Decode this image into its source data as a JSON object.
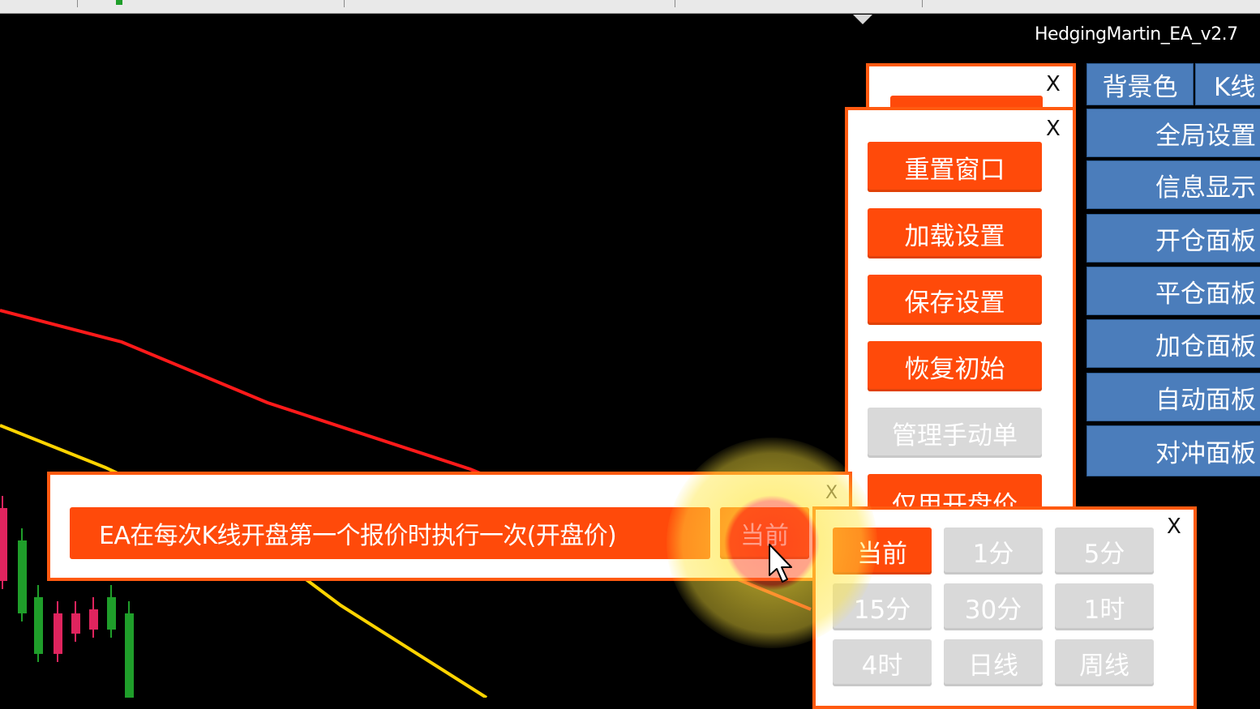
{
  "app": {
    "ea_name": "HedgingMartin_EA_v2.7"
  },
  "colors": {
    "accent": "#ff4a0a",
    "disabled": "#d9d9d9",
    "side_blue": "#4b7dbb",
    "ma_red": "#ff1a1a",
    "ma_yellow": "#ffd400",
    "bull": "#1f9e2a",
    "bear": "#e0245e"
  },
  "side_menu": {
    "top_row": [
      "背景色",
      "K线"
    ],
    "items": [
      "全局设置",
      "信息显示",
      "开仓面板",
      "平仓面板",
      "加仓面板",
      "自动面板",
      "对冲面板"
    ]
  },
  "settings_panel": {
    "close": "X",
    "back_close": "X",
    "buttons": [
      {
        "label": "重置窗口",
        "state": "active"
      },
      {
        "label": "加载设置",
        "state": "active"
      },
      {
        "label": "保存设置",
        "state": "active"
      },
      {
        "label": "恢复初始",
        "state": "active"
      },
      {
        "label": "管理手动单",
        "state": "disabled"
      },
      {
        "label": "仅用开盘价",
        "state": "active"
      }
    ]
  },
  "exec_panel": {
    "description": "EA在每次K线开盘第一个报价时执行一次(开盘价)",
    "timeframe_button": "当前",
    "close": "X"
  },
  "timeframe_panel": {
    "close": "X",
    "options": [
      {
        "label": "当前",
        "selected": true
      },
      {
        "label": "1分",
        "selected": false
      },
      {
        "label": "5分",
        "selected": false
      },
      {
        "label": "15分",
        "selected": false
      },
      {
        "label": "30分",
        "selected": false
      },
      {
        "label": "1时",
        "selected": false
      },
      {
        "label": "4时",
        "selected": false
      },
      {
        "label": "日线",
        "selected": false
      },
      {
        "label": "周线",
        "selected": false
      }
    ]
  }
}
